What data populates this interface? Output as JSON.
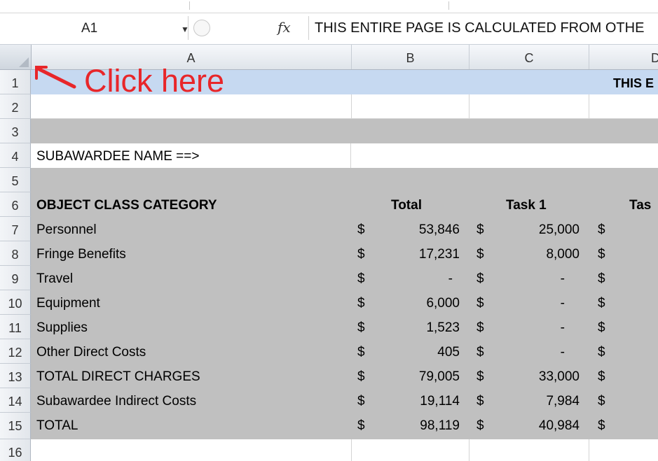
{
  "formula_bar": {
    "cell_ref": "A1",
    "fx": "fx",
    "content": "THIS ENTIRE PAGE IS CALCULATED FROM OTHE"
  },
  "columns": [
    "A",
    "B",
    "C",
    "D"
  ],
  "annotation": "Click here",
  "rows": {
    "r1_text": "THIS E",
    "r4_label": "SUBAWARDEE NAME ==>",
    "header": {
      "label": "OBJECT CLASS CATEGORY",
      "total": "Total",
      "task1": "Task 1",
      "task2": "Tas"
    },
    "items": [
      {
        "label": "Personnel",
        "total": "53,846",
        "task1": "25,000"
      },
      {
        "label": "Fringe Benefits",
        "total": "17,231",
        "task1": "8,000"
      },
      {
        "label": "Travel",
        "total": "-",
        "task1": "-"
      },
      {
        "label": "Equipment",
        "total": "6,000",
        "task1": "-"
      },
      {
        "label": "Supplies",
        "total": "1,523",
        "task1": "-"
      },
      {
        "label": "Other Direct Costs",
        "total": "405",
        "task1": "-"
      },
      {
        "label": "TOTAL DIRECT CHARGES",
        "total": "79,005",
        "task1": "33,000"
      },
      {
        "label": "Subawardee Indirect Costs",
        "total": "19,114",
        "task1": "7,984"
      },
      {
        "label": "TOTAL",
        "total": "98,119",
        "task1": "40,984"
      }
    ],
    "currency": "$"
  },
  "row_numbers": [
    "1",
    "2",
    "3",
    "4",
    "5",
    "6",
    "7",
    "8",
    "9",
    "10",
    "11",
    "12",
    "13",
    "14",
    "15",
    "16"
  ],
  "colors": {
    "row1_fill": "#c6d9f1",
    "gray_fill": "#c0c0c0",
    "annotation": "#e8262a"
  }
}
